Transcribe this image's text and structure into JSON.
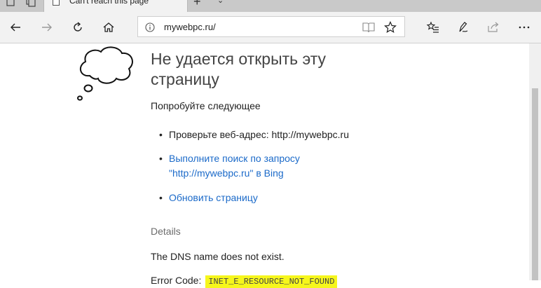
{
  "tab": {
    "title": "Can't reach this page",
    "close": "✕",
    "new_tab": "+",
    "dropdown": "⌄"
  },
  "address_bar": {
    "url": "mywebpc.ru/"
  },
  "icons": {
    "back": "back-arrow-icon",
    "forward": "forward-arrow-icon",
    "refresh": "refresh-icon",
    "home": "home-icon",
    "info": "info-icon",
    "reading_view": "book-icon",
    "favorite": "star-icon",
    "favorites_hub": "favorites-hub-icon",
    "notes": "pen-icon",
    "share": "share-icon",
    "more": "more-icon"
  },
  "error_page": {
    "heading": "Не удается открыть эту страницу",
    "try_label": "Попробуйте следующее",
    "bullets": {
      "check_address": "Проверьте веб-адрес: http://mywebpc.ru",
      "search_line1": "Выполните поиск по запросу",
      "search_line2": "\"http://mywebpc.ru\" в Bing",
      "refresh": "Обновить страницу"
    },
    "details_label": "Details",
    "dns_message": "The DNS name does not exist.",
    "error_code_label": "Error Code:",
    "error_code": "INET_E_RESOURCE_NOT_FOUND"
  },
  "colors": {
    "link": "#1b6ac9",
    "highlight": "#f6f61c",
    "toolbar": "#f2f2f2"
  }
}
